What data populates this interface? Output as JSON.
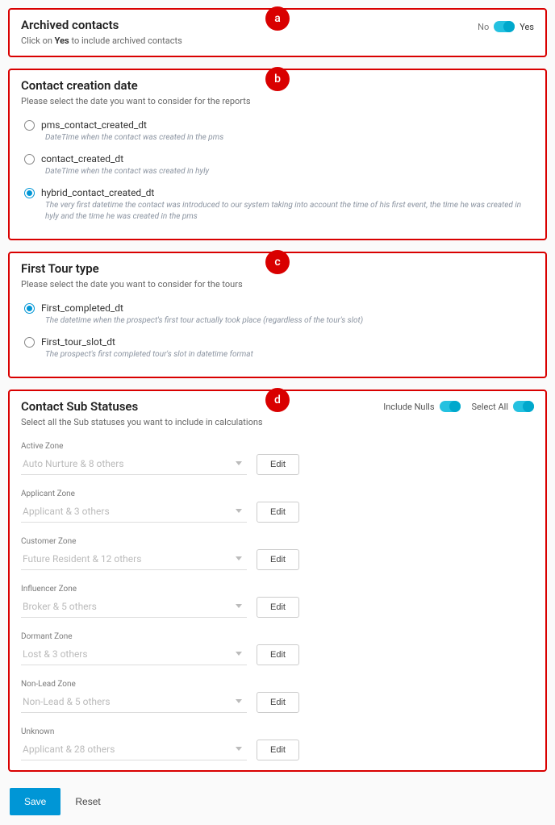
{
  "markers": {
    "a": "a",
    "b": "b",
    "c": "c",
    "d": "d"
  },
  "archived": {
    "title": "Archived contacts",
    "desc_pre": "Click on ",
    "desc_bold": "Yes",
    "desc_post": " to include archived contacts",
    "no_label": "No",
    "yes_label": "Yes"
  },
  "creation": {
    "title": "Contact creation date",
    "desc": "Please select the date you want to consider for the reports",
    "options": [
      {
        "label": "pms_contact_created_dt",
        "help": "DateTime when the contact was created in the pms",
        "checked": false
      },
      {
        "label": "contact_created_dt",
        "help": "DateTime when the contact was created in hyly",
        "checked": false
      },
      {
        "label": "hybrid_contact_created_dt",
        "help": "The very first datetime the contact was introduced to our system taking into account the time of his first event, the time he was created in hyly and the time he was created in the pms",
        "checked": true
      }
    ]
  },
  "tour": {
    "title": "First Tour type",
    "desc": "Please select the date you want to consider for the tours",
    "options": [
      {
        "label": "First_completed_dt",
        "help": "The datetime when the prospect's first tour actually took place (regardless of the tour's slot)",
        "checked": true
      },
      {
        "label": "First_tour_slot_dt",
        "help": "The prospect's first completed tour's slot in datetime format",
        "checked": false
      }
    ]
  },
  "sub": {
    "title": "Contact Sub Statuses",
    "desc": "Select all the Sub statuses you want to include in calculations",
    "include_nulls_label": "Include Nulls",
    "select_all_label": "Select All",
    "edit_label": "Edit",
    "zones": [
      {
        "label": "Active Zone",
        "value": "Auto Nurture & 8 others"
      },
      {
        "label": "Applicant Zone",
        "value": "Applicant & 3 others"
      },
      {
        "label": "Customer Zone",
        "value": "Future Resident & 12 others"
      },
      {
        "label": "Influencer Zone",
        "value": "Broker & 5 others"
      },
      {
        "label": "Dormant Zone",
        "value": "Lost & 3 others"
      },
      {
        "label": "Non-Lead Zone",
        "value": "Non-Lead & 5 others"
      },
      {
        "label": "Unknown",
        "value": "Applicant & 28 others"
      }
    ]
  },
  "footer": {
    "save": "Save",
    "reset": "Reset"
  }
}
